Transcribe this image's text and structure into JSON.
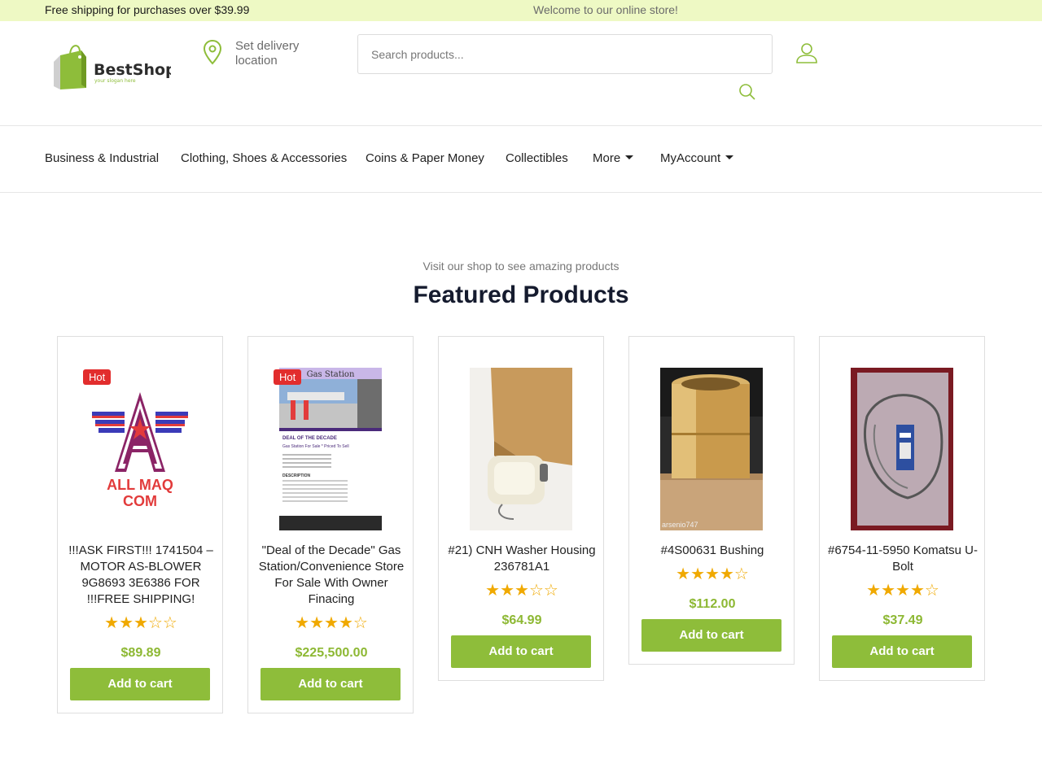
{
  "topbar": {
    "shipping_text": "Free shipping for purchases over $39.99",
    "welcome_text": "Welcome to our online store!"
  },
  "header": {
    "logo_name": "BestShop",
    "logo_slogan": "your slogan here",
    "delivery_label": "Set delivery location",
    "search_placeholder": "Search products..."
  },
  "nav": {
    "items": [
      {
        "label": "Business & Industrial"
      },
      {
        "label": "Clothing, Shoes & Accessories"
      },
      {
        "label": "Coins & Paper Money"
      },
      {
        "label": "Collectibles"
      },
      {
        "label": "More"
      },
      {
        "label": "MyAccount"
      }
    ]
  },
  "section": {
    "subtitle": "Visit our shop to see amazing products",
    "title": "Featured Products"
  },
  "products": [
    {
      "name": "!!!ASK FIRST!!! 1741504 – MOTOR AS-BLOWER 9G8693 3E6386 FOR !!!FREE SHIPPING!",
      "rating": 3,
      "price": "$89.89",
      "badge": "Hot",
      "button": "Add to cart"
    },
    {
      "name": "\"Deal of the Decade\" Gas Station/Convenience Store For Sale With Owner Finacing",
      "rating": 4,
      "price": "$225,500.00",
      "badge": "Hot",
      "button": "Add to cart"
    },
    {
      "name": "#21) CNH Washer Housing 236781A1",
      "rating": 3,
      "price": "$64.99",
      "badge": "",
      "button": "Add to cart"
    },
    {
      "name": "#4S00631 Bushing",
      "rating": 4,
      "price": "$112.00",
      "badge": "",
      "button": "Add to cart"
    },
    {
      "name": "#6754-11-5950 Komatsu U-Bolt",
      "rating": 4,
      "price": "$37.49",
      "badge": "",
      "button": "Add to cart"
    }
  ],
  "images": {
    "p1_text1": "ALL MAQ",
    "p1_text2": "COM",
    "p2_header": "Gas Station",
    "p2_deal": "DEAL OF THE DECADE",
    "p2_sub": "Gas Station For Sale * Priced To Sell",
    "p2_desc": "DESCRIPTION",
    "p4_watermark": "arsenio747"
  },
  "colors": {
    "topbar_bg": "#eef9c4",
    "accent": "#8ebd3a",
    "price": "#8db833",
    "hot_badge": "#e22d2d",
    "stars": "#f0a900"
  }
}
